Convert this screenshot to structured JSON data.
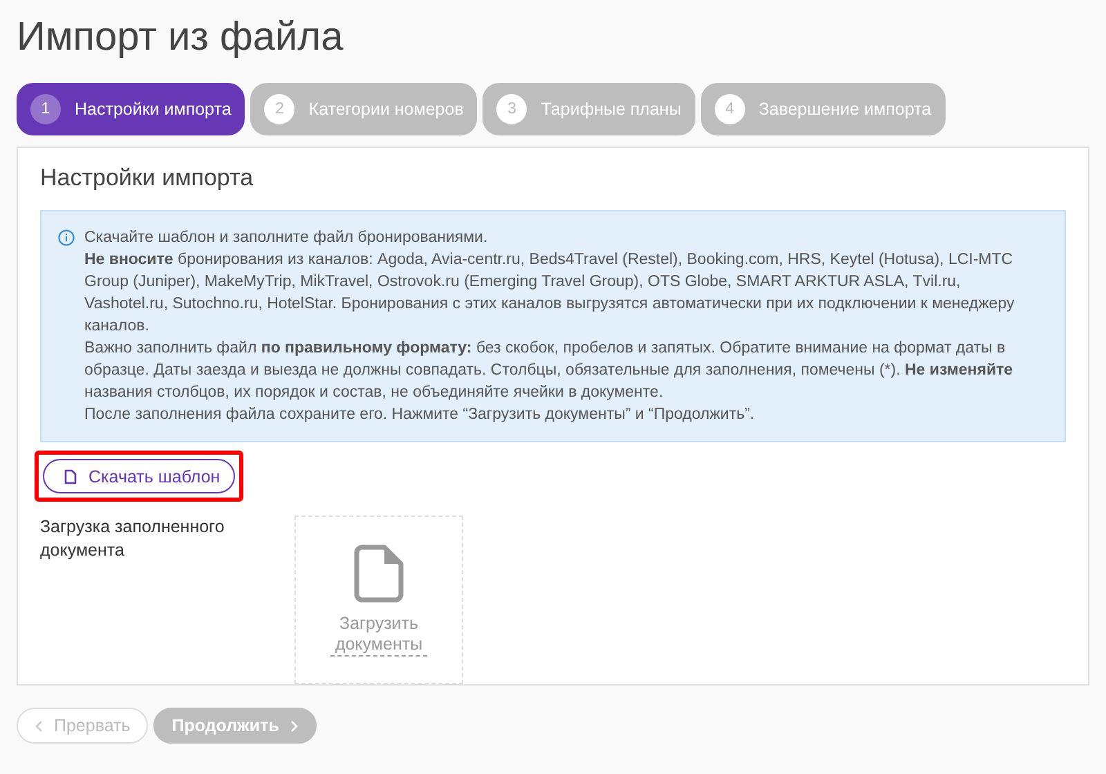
{
  "page_title": "Импорт из файла",
  "steps": [
    {
      "number": "1",
      "label": "Настройки импорта",
      "selected": true
    },
    {
      "number": "2",
      "label": "Категории номеров",
      "selected": false
    },
    {
      "number": "3",
      "label": "Тарифные планы",
      "selected": false
    },
    {
      "number": "4",
      "label": "Завершение импорта",
      "selected": false
    }
  ],
  "panel": {
    "title": "Настройки импорта",
    "info": [
      "Скачайте шаблон и заполните файл бронированиями.",
      "**Не вносите** бронирования из каналов: Agoda, Avia-centr.ru, Beds4Travel (Restel), Booking.com, HRS, Keytel (Hotusa), LCI-MTC Group (Juniper), MakeMyTrip, MikTravel, Ostrovok.ru (Emerging Travel Group), OTS Globe, SMART ARKTUR ASLA, Tvil.ru, Vashotel.ru, Sutochno.ru, HotelStar. Бронирования с этих каналов выгрузятся автоматически при их подключении к менеджеру каналов.",
      "Важно заполнить файл **по правильному формату:** без скобок, пробелов и запятых. Обратите внимание на формат даты в образце. Даты заезда и выезда не должны совпадать. Столбцы, обязательные для заполнения, помечены (*). **Не изменяйте** названия столбцов, их порядок и состав, не объединяйте ячейки в документе.",
      "После заполнения файла сохраните его. Нажмите “Загрузить документы” и “Продолжить”."
    ],
    "download_button": {
      "label": "Скачать шаблон",
      "highlighted": true
    },
    "upload_label": "Загрузка заполненного документа",
    "upload_link": "Загрузить документы"
  },
  "footer": {
    "buttons": [
      {
        "label": "Прервать",
        "kind": "back"
      },
      {
        "label": "Продолжить",
        "kind": "next"
      }
    ]
  }
}
